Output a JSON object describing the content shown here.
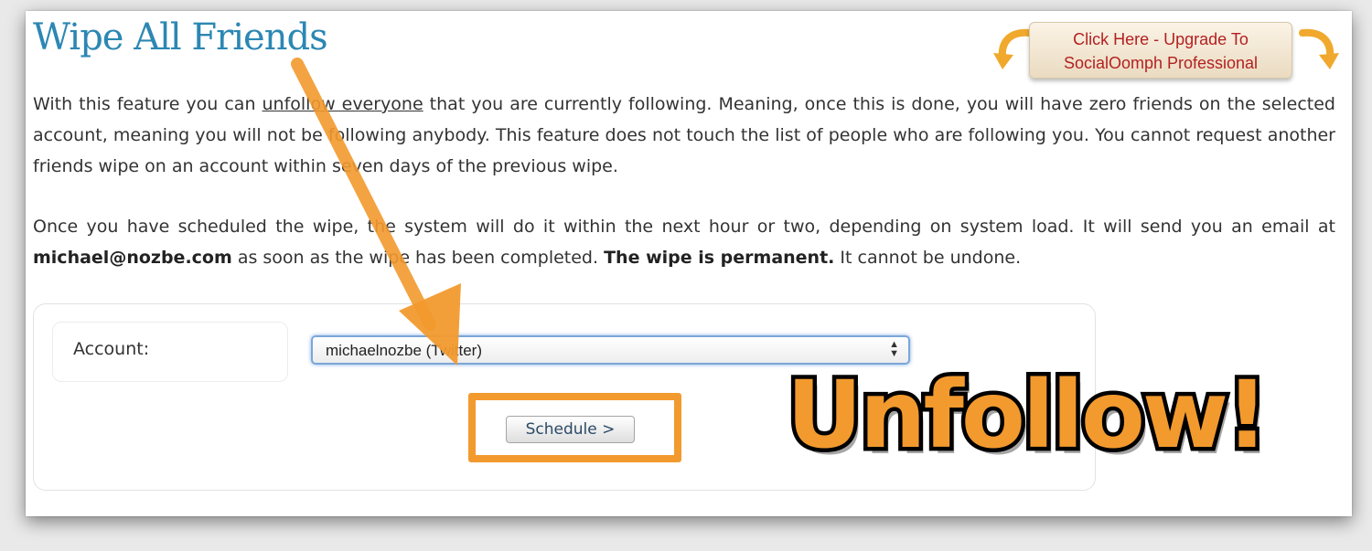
{
  "page": {
    "title": "Wipe All Friends",
    "upgrade_button": {
      "line1": "Click Here - Upgrade To",
      "line2": "SocialOomph Professional"
    },
    "description": {
      "p1_before": "With this feature you can ",
      "p1_link": "unfollow everyone",
      "p1_after": " that you are currently following. Meaning, once this is done, you will have zero friends on the selected account, meaning you will not be following anybody. This feature does not touch the list of people who are following you. You cannot request another friends wipe on an account within seven days of the previous wipe.",
      "p2_before": "Once you have scheduled the wipe, the system will do it within the next hour or two, depending on system load. It will send you an email at ",
      "p2_email": "michael@nozbe.com",
      "p2_middle": " as soon as the wipe has been completed. ",
      "p2_bold": "The wipe is permanent.",
      "p2_after": " It cannot be undone."
    },
    "form": {
      "account_label": "Account:",
      "account_value": "michaelnozbe (Twitter)",
      "schedule_button": "Schedule >"
    },
    "overlay": {
      "caption": "Unfollow!",
      "accent_color": "#f29a2e"
    }
  }
}
